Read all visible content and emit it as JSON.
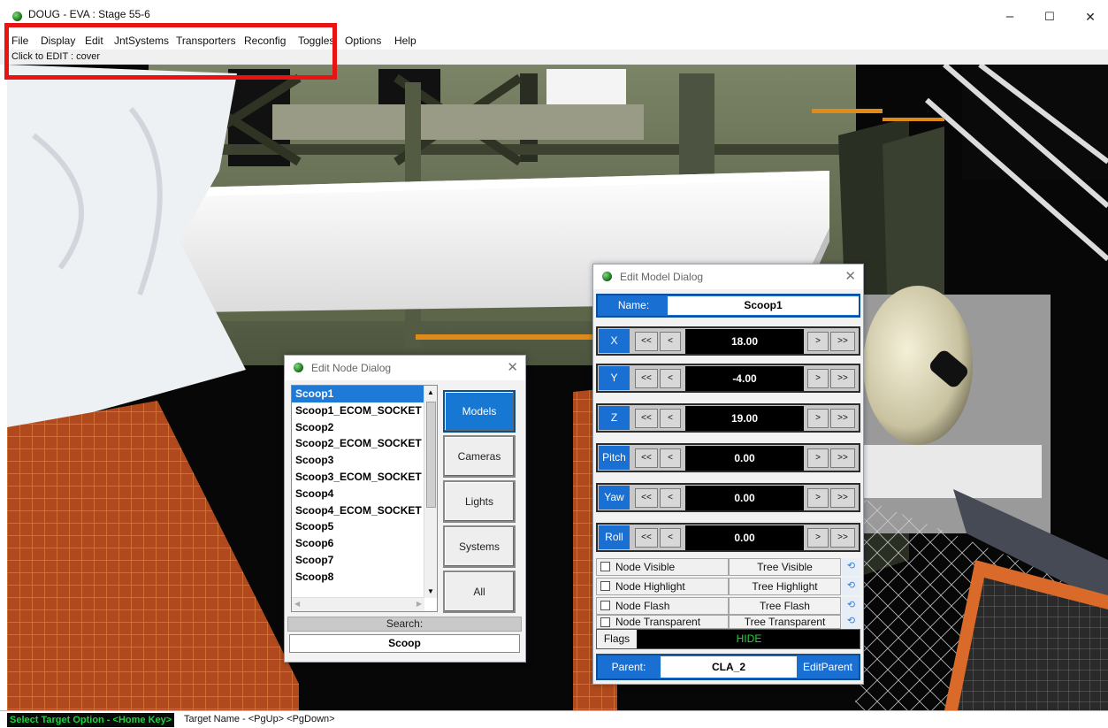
{
  "window": {
    "title": "DOUG - EVA : Stage 55-6",
    "minimize": "–",
    "maximize": "☐",
    "close": "✕"
  },
  "menu": [
    "File",
    "Display",
    "Edit",
    "JntSystems",
    "Transporters",
    "Reconfig",
    "Toggles",
    "Options",
    "Help"
  ],
  "edit_bar": "Click to EDIT : cover",
  "status": {
    "left": "Select Target Option - <Home Key>",
    "right": "Target Name - <PgUp> <PgDown>"
  },
  "node_dialog": {
    "title": "Edit Node Dialog",
    "close": "✕",
    "items": [
      "Scoop1",
      "Scoop1_ECOM_SOCKET",
      "Scoop2",
      "Scoop2_ECOM_SOCKET",
      "Scoop3",
      "Scoop3_ECOM_SOCKET",
      "Scoop4",
      "Scoop4_ECOM_SOCKET",
      "Scoop5",
      "Scoop6",
      "Scoop7",
      "Scoop8"
    ],
    "selected": "Scoop1",
    "categories": [
      "Models",
      "Cameras",
      "Lights",
      "Systems",
      "All"
    ],
    "active_category": "Models",
    "search_label": "Search:",
    "search_value": "Scoop"
  },
  "model_dialog": {
    "title": "Edit Model Dialog",
    "close": "✕",
    "name_label": "Name:",
    "name_value": "Scoop1",
    "step_labels": [
      "<<",
      "<",
      ">",
      ">>"
    ],
    "coords": [
      {
        "label": "X",
        "value": "18.00"
      },
      {
        "label": "Y",
        "value": "-4.00"
      },
      {
        "label": "Z",
        "value": "19.00"
      },
      {
        "label": "Pitch",
        "value": "0.00"
      },
      {
        "label": "Yaw",
        "value": "0.00"
      },
      {
        "label": "Roll",
        "value": "0.00"
      }
    ],
    "node_flags": [
      "Node Visible",
      "Node Highlight",
      "Node Flash",
      "Node Transparent"
    ],
    "tree_flags": [
      "Tree Visible",
      "Tree Highlight",
      "Tree Flash",
      "Tree Transparent"
    ],
    "tree_reset_icon": "⟲",
    "flags_label": "Flags",
    "flags_value": "HIDE",
    "parent_label": "Parent:",
    "parent_value": "CLA_2",
    "edit_parent": "EditParent"
  },
  "colors": {
    "accent_blue": "#1a6fd3",
    "annotation_red": "#e81414",
    "status_green": "#19d63c"
  }
}
